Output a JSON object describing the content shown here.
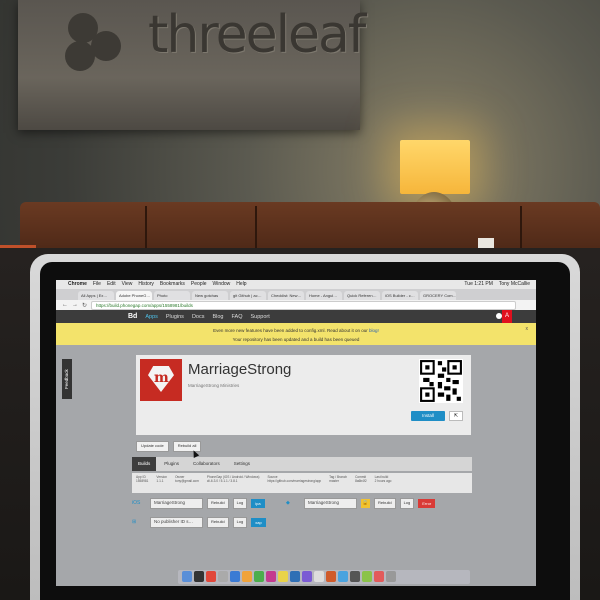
{
  "background": {
    "wall_sign_text": "threeleaf"
  },
  "browser": {
    "menubar": {
      "app": "Chrome",
      "items": [
        "File",
        "Edit",
        "View",
        "History",
        "Bookmarks",
        "People",
        "Window",
        "Help"
      ],
      "clock": "Tue 1:21 PM",
      "user": "Tony McCallie"
    },
    "tabs": [
      "All Apps | Ex…",
      "Adobe PhoneG…",
      "Photo",
      "New gotchas",
      "git Github | ac…",
      "Checklist: New…",
      "Home - Angul…",
      "Quick Referen…",
      "iOS Builder - c…",
      "GROCERY Com…"
    ],
    "url": "https://build.phonegap.com/apps/1558981/builds"
  },
  "site": {
    "brand": "Bd",
    "nav": [
      "Apps",
      "Plugins",
      "Docs",
      "Blog",
      "FAQ",
      "Support"
    ],
    "notice": {
      "line1": "Even more new features have been added to config.xml. Read about it on our",
      "link": "blog!",
      "line2": "Your repository has been updated and a build has been queued",
      "close": "x"
    },
    "feedback_tab": "Feedback",
    "app": {
      "icon_letter": "m",
      "name": "MarriageStrong",
      "subtitle": "MarriageStrong Ministries",
      "install_label": "Install",
      "share_label": "⇱",
      "update_code": "Update code",
      "rebuild_all": "Rebuild all"
    },
    "tabs": [
      "Builds",
      "Plugins",
      "Collaborators",
      "Settings"
    ],
    "info_columns": [
      {
        "label": "App ID",
        "value": "1558981"
      },
      {
        "label": "Version",
        "value": "1.1.1"
      },
      {
        "label": "Owner",
        "value": "tony@gmail.com"
      },
      {
        "label": "PhoneGap (iOS / Android / Windows)",
        "value": "cli-6.3.0 / 5.1.1 / 3.8.1"
      },
      {
        "label": "Source",
        "value": "https://github.com/marriagestrong/app"
      },
      {
        "label": "Tag / Branch",
        "value": "master"
      },
      {
        "label": "Commit",
        "value": "8a6b4f2"
      },
      {
        "label": "Last build",
        "value": "2 hours ago"
      }
    ],
    "platforms": {
      "ios": {
        "label": "iOS",
        "selected": "MarriageStrong",
        "rebuild": "Rebuild",
        "log": "Log",
        "download": "ipa"
      },
      "android": {
        "selected": "MarriageStrong",
        "lock": "🔒",
        "rebuild": "Rebuild",
        "log": "Log",
        "status": "Error"
      },
      "windows": {
        "selected": "No publisher ID s…",
        "rebuild": "Rebuild",
        "log": "Log",
        "download": "xap"
      }
    }
  }
}
